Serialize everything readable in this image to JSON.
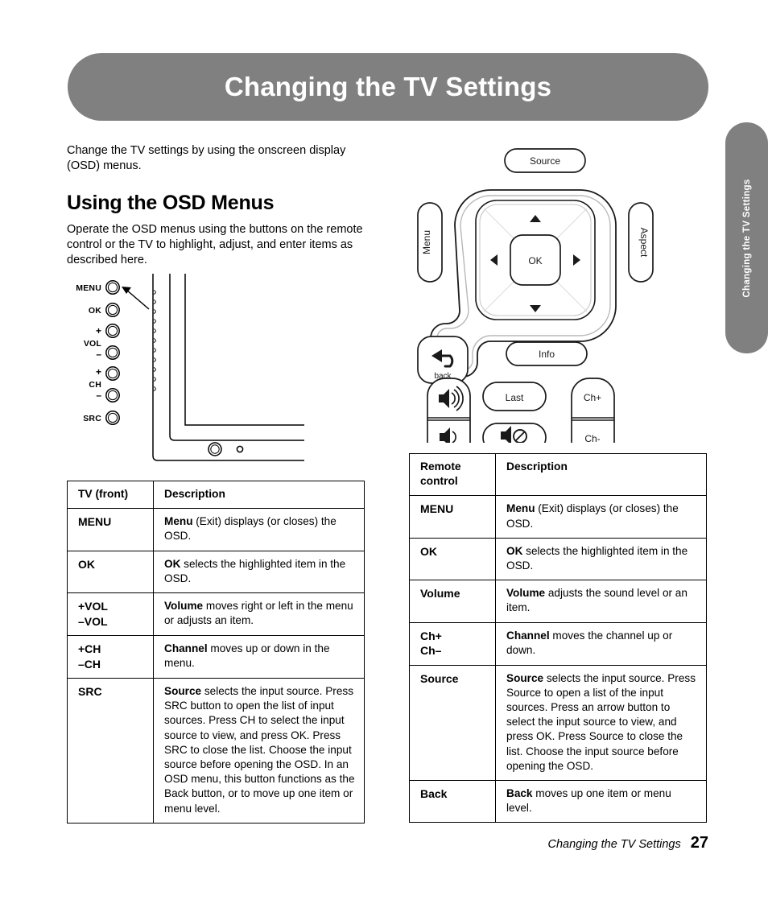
{
  "banner": {
    "title": "Changing the TV Settings"
  },
  "side_tab": {
    "label": "Changing the TV Settings"
  },
  "intro": {
    "paragraph": "Change the TV settings by using the onscreen display (OSD) menus."
  },
  "section": {
    "heading": "Using the OSD Menus",
    "paragraph": "Operate the OSD menus using the buttons on the remote control or the TV to highlight, adjust, and enter items as described here."
  },
  "tv_front_diagram": {
    "labels": {
      "menu": "MENU",
      "ok": "OK",
      "vol": "VOL",
      "vol_plus": "+",
      "vol_minus": "–",
      "ch": "CH",
      "ch_plus": "+",
      "ch_minus": "–",
      "src": "SRC"
    }
  },
  "remote_diagram": {
    "source": "Source",
    "menu": "Menu",
    "aspect": "Aspect",
    "ok": "OK",
    "back": "back",
    "info": "Info",
    "last": "Last",
    "ch_plus": "Ch+",
    "ch_minus": "Ch-"
  },
  "table_tv_front": {
    "headers": [
      "TV (front)",
      "Description"
    ],
    "rows": [
      {
        "key": "MENU",
        "desc_bold": "Menu",
        "desc_rest": " (Exit) displays (or closes) the OSD."
      },
      {
        "key": "OK",
        "desc_bold": "OK",
        "desc_rest": " selects the highlighted item in the OSD."
      },
      {
        "key": "+VOL\n–VOL",
        "desc_bold": "Volume",
        "desc_rest": " moves right or left in the menu or adjusts an item."
      },
      {
        "key": "+CH\n–CH",
        "desc_bold": "Channel",
        "desc_rest": " moves up or down in the menu."
      },
      {
        "key": "SRC",
        "desc_bold": "Source",
        "desc_rest": " selects the input source. Press SRC button to open the list of input sources. Press CH to select the input source to view, and press OK. Press SRC to close the list. Choose the input source before opening the OSD. In an OSD menu, this button functions as the Back button, or to move up one item or menu level."
      }
    ]
  },
  "table_remote": {
    "headers": [
      "Remote\ncontrol",
      "Description"
    ],
    "rows": [
      {
        "key": "MENU",
        "desc_bold": "Menu",
        "desc_rest": " (Exit) displays (or closes) the OSD."
      },
      {
        "key": "OK",
        "desc_bold": "OK",
        "desc_rest": " selects the highlighted item in the OSD."
      },
      {
        "key": "Volume",
        "desc_bold": "Volume",
        "desc_rest": " adjusts the sound level or an item."
      },
      {
        "key": "Ch+\nCh–",
        "desc_bold": "Channel",
        "desc_rest": " moves the channel up or down."
      },
      {
        "key": "Source",
        "desc_bold": "Source",
        "desc_rest": " selects the input source. Press Source to open a list of the input sources. Press an arrow button to select the input source to view, and press OK. Press Source to close the list. Choose the input source before opening the OSD."
      },
      {
        "key": "Back",
        "desc_bold": "Back",
        "desc_rest": " moves up one item or menu level."
      }
    ]
  },
  "footer": {
    "chapter": "Changing the TV Settings",
    "page_number": "27"
  },
  "colors": {
    "banner_gray": "#808080",
    "text_black": "#000000",
    "banner_text": "#ffffff"
  }
}
